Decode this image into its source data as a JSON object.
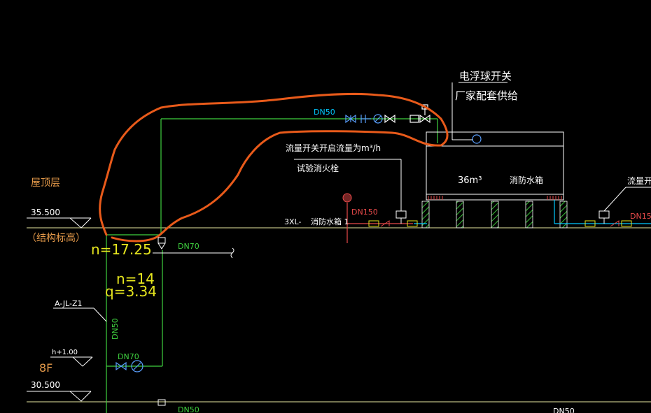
{
  "colors": {
    "background": "#000000",
    "floor_line": "#e8e8a0",
    "pipe_green": "#3fd13f",
    "pipe_cyan": "#00c8ff",
    "valve_blue": "#5aa0ff",
    "text_white": "#ffffff",
    "text_orange": "#e59a4a",
    "text_yellow": "#e6e61e",
    "hydrant_red": "#e84a4a",
    "hatch_green": "#39c239",
    "markup_orange": "#e85a1a"
  },
  "icons": [
    "gate-valve-icon",
    "check-valve-icon",
    "float-valve-icon",
    "flow-switch-icon",
    "pressure-gauge-icon",
    "hydrant-icon"
  ],
  "labels": {
    "roof_level": "屋顶层",
    "elev_roof": "35.500",
    "structural_elev": "（结构标高）",
    "pipe_dn50_top": "DN50",
    "float_switch": "电浮球开关",
    "vendor_supply": "厂家配套供给",
    "flow_switch_note": "流量开关开启流量为m³/h",
    "test_hydrant": "试验消火栓",
    "tank_volume": "36m³",
    "tank_name": "消防水箱",
    "flow_right": "流量开",
    "dn150": "DN150",
    "dn15_right": "DN15",
    "xl_label": "3XL-",
    "tank_no": "消防水箱 1",
    "dn70_a": "DN70",
    "dn70_b": "DN70",
    "n_17": "n=17.25",
    "n_14": "n=14",
    "q_val": "q=3.34",
    "riser": "A-JL-Z1",
    "dn50_riser": "DN50",
    "h_offset": "h+1.00",
    "floor_8f": "8F",
    "elev_8f": "30.500",
    "dn50_bottom": "DN50",
    "dn50_bottom_right": "DN50"
  }
}
